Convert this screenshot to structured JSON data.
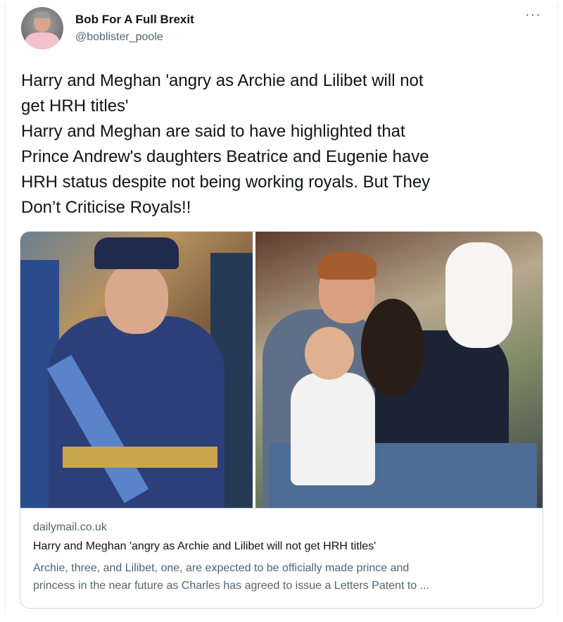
{
  "author": {
    "display_name": "Bob For A Full Brexit",
    "handle": "@boblister_poole",
    "avatar_icon": "user-avatar-photo"
  },
  "menu": {
    "more_label": "···"
  },
  "tweet": {
    "lines": [
      "Harry and Meghan 'angry as Archie and Lilibet will not",
      "get HRH titles'",
      "Harry and Meghan are said to have highlighted that",
      "Prince Andrew's daughters Beatrice and Eugenie have",
      "HRH status despite not being working royals. But They",
      "Don’t Criticise Royals!!"
    ]
  },
  "link_card": {
    "images": [
      "military-uniform-photo",
      "family-photo"
    ],
    "domain": "dailymail.co.uk",
    "title": "Harry and Meghan 'angry as Archie and Lilibet will not get HRH titles'",
    "description_lines": [
      "Archie, three, and Lilibet, one, are expected to be officially made prince and",
      "princess in the near future as Charles has agreed to issue a Letters Patent to ..."
    ]
  },
  "colors": {
    "text_primary": "#0f1419",
    "text_secondary": "#536471",
    "border": "#cfd9de"
  }
}
